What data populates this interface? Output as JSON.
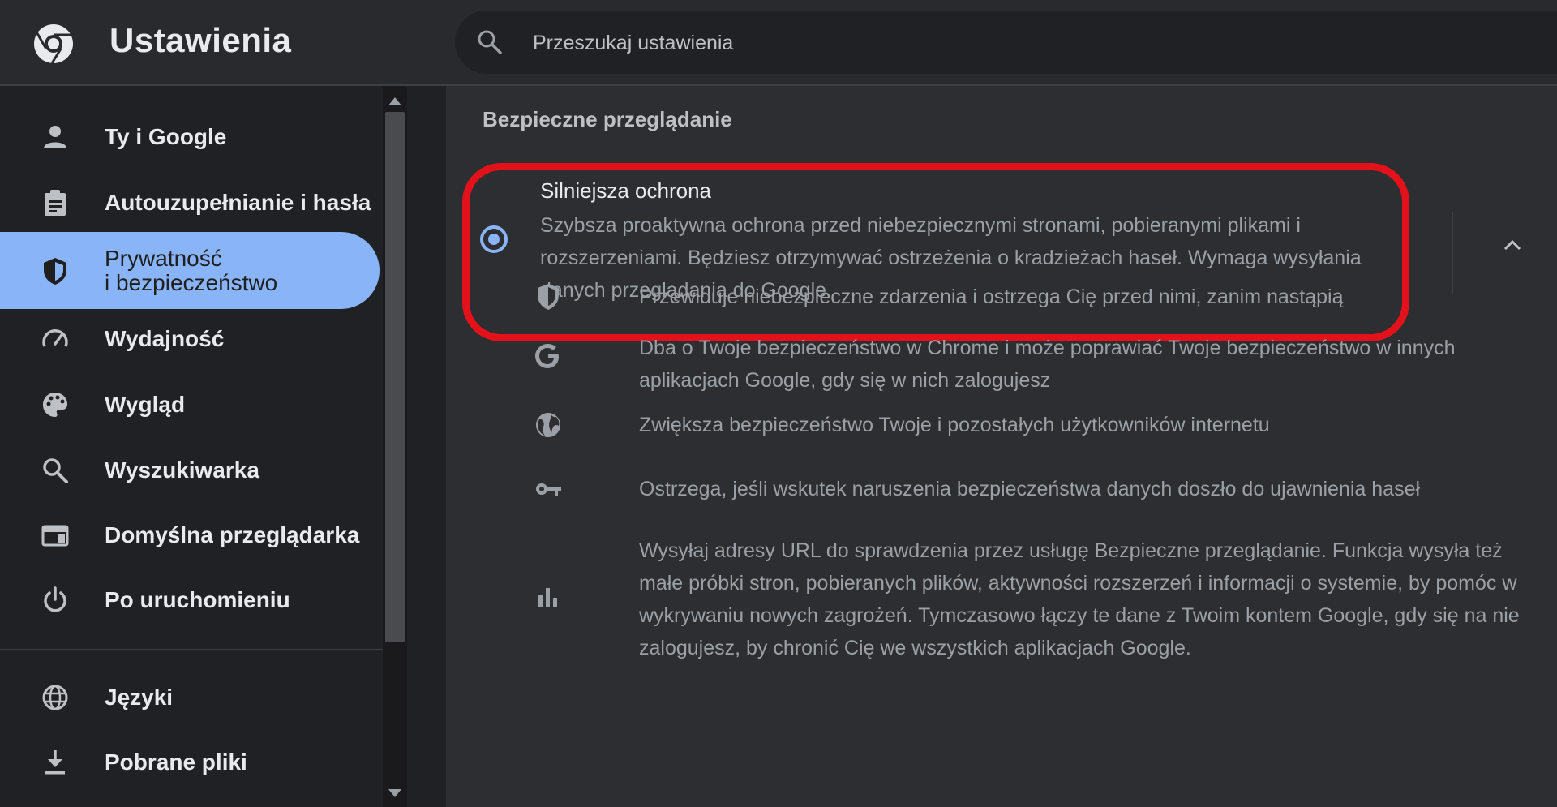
{
  "header": {
    "title": "Ustawienia",
    "search_placeholder": "Przeszukaj ustawienia"
  },
  "sidebar": {
    "items": [
      {
        "label": "Ty i Google",
        "icon": "person-icon"
      },
      {
        "label": "Autouzupełnianie i hasła",
        "icon": "clipboard-icon"
      },
      {
        "label_line1": "Prywatność",
        "label_line2": "i bezpieczeństwo",
        "icon": "shield-icon",
        "active": true
      },
      {
        "label": "Wydajność",
        "icon": "speedometer-icon"
      },
      {
        "label": "Wygląd",
        "icon": "palette-icon"
      },
      {
        "label": "Wyszukiwarka",
        "icon": "search-icon"
      },
      {
        "label": "Domyślna przeglądarka",
        "icon": "browser-window-icon"
      },
      {
        "label": "Po uruchomieniu",
        "icon": "power-icon"
      },
      {
        "label": "Języki",
        "icon": "globe-icon"
      },
      {
        "label": "Pobrane pliki",
        "icon": "download-icon"
      }
    ]
  },
  "main": {
    "section_title": "Bezpieczne przeglądanie",
    "selected_option": {
      "title": "Silniejsza ochrona",
      "description": "Szybsza proaktywna ochrona przed niebezpiecznymi stronami, pobieranymi plikami i rozszerzeniami. Będziesz otrzymywać ostrzeżenia o kradzieżach haseł. Wymaga wysyłania danych przeglądania do Google."
    },
    "features": [
      {
        "icon": "shield-icon",
        "text": "Przewiduje niebezpieczne zdarzenia i ostrzega Cię przed nimi, zanim nastąpią"
      },
      {
        "icon": "google-g-icon",
        "text": "Dba o Twoje bezpieczeństwo w Chrome i może poprawiać Twoje bezpieczeństwo w innych aplikacjach Google, gdy się w nich zalogujesz"
      },
      {
        "icon": "globe-icon",
        "text": "Zwiększa bezpieczeństwo Twoje i pozostałych użytkowników internetu"
      },
      {
        "icon": "key-icon",
        "text": "Ostrzega, jeśli wskutek naruszenia bezpieczeństwa danych doszło do ujawnienia haseł"
      },
      {
        "icon": "bar-chart-icon",
        "text": "Wysyłaj adresy URL do sprawdzenia przez usługę Bezpieczne przeglądanie. Funkcja wysyła też małe próbki stron, pobieranych plików, aktywności rozszerzeń i informacji o systemie, by pomóc w wykrywaniu nowych zagrożeń. Tymczasowo łączy te dane z Twoim kontem Google, gdy się na nie zalogujesz, by chronić Cię we wszystkich aplikacjach Google."
      }
    ]
  },
  "colors": {
    "accent": "#8ab4f8",
    "highlight_border": "#e3121a",
    "background": "#202124",
    "panel": "#2d2e31"
  }
}
